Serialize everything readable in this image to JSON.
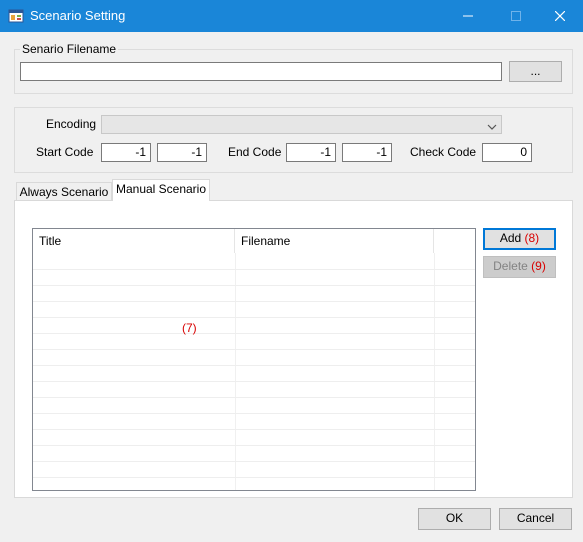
{
  "window": {
    "title": "Scenario Setting",
    "icon": "app-window-icon"
  },
  "filename_group": {
    "legend": "Senario Filename",
    "value": "",
    "browse_label": "..."
  },
  "encoding_group": {
    "encoding_label": "Encoding",
    "encoding_value": "",
    "start_code_label": "Start Code",
    "start_code_1": "-1",
    "start_code_2": "-1",
    "end_code_label": "End Code",
    "end_code_1": "-1",
    "end_code_2": "-1",
    "check_code_label": "Check Code",
    "check_code": "0"
  },
  "tabs": [
    {
      "label": "Always Scenario",
      "active": false
    },
    {
      "label": "Manual Scenario",
      "active": true
    }
  ],
  "list": {
    "columns": [
      "Title",
      "Filename",
      ""
    ],
    "rows": [],
    "marker": "(7)"
  },
  "side_buttons": {
    "add_label": "Add",
    "add_marker": "(8)",
    "delete_label": "Delete",
    "delete_marker": "(9)"
  },
  "footer": {
    "ok_label": "OK",
    "cancel_label": "Cancel"
  },
  "colors": {
    "titlebar": "#1a86d8",
    "annotation": "#d80000",
    "focus_border": "#0078d7"
  }
}
